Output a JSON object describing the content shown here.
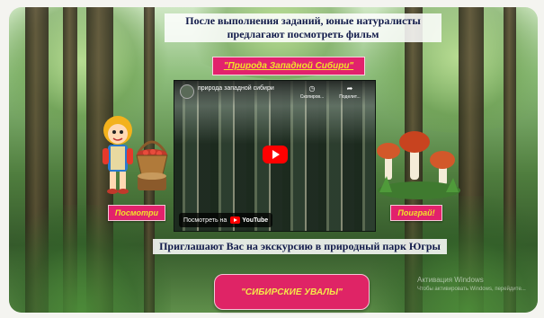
{
  "header": {
    "line1": "После выполнения заданий, юные натуралисты",
    "line2": "предлагают посмотреть фильм"
  },
  "film_title": "\"Природа Западной Сибири\"",
  "video": {
    "title": "природа западной сибири",
    "copy_link_label": "Скопиров...",
    "share_label": "Поделит...",
    "watch_on_label": "Посмотреть на",
    "youtube_label": "YouTube",
    "play_color": "#ff0000"
  },
  "buttons": {
    "watch": "Посмотри",
    "play": "Поиграй!",
    "park": "\"СИБИРСКИЕ УВАЛЫ\""
  },
  "invitation": "Приглашают Вас на экскурсию в природный парк Югры",
  "watermark": {
    "line1": "Активация Windows",
    "line2": "Чтобы активировать Windows, перейдите..."
  },
  "colors": {
    "accent_pink": "#e2226c",
    "accent_yellow": "#f1e22a",
    "text_navy": "#111a4a"
  }
}
